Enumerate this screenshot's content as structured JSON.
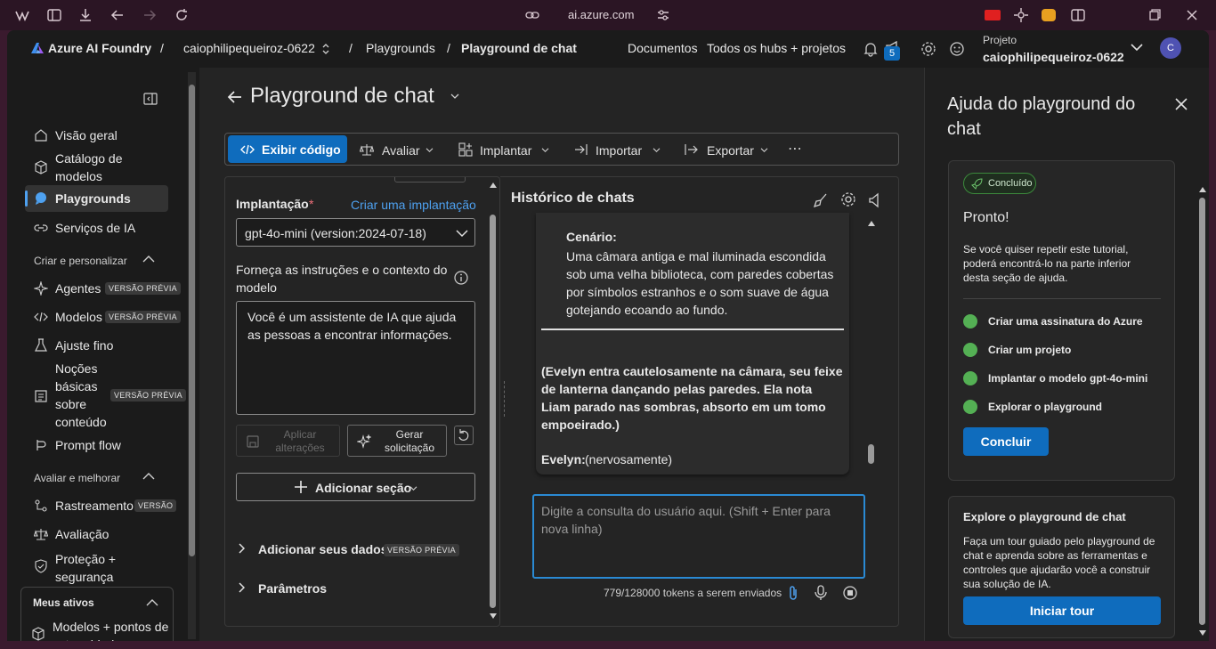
{
  "browser": {
    "url": "ai.azure.com"
  },
  "topnav": {
    "brand": "Azure AI Foundry",
    "project_crumb": "caiophilipequeiroz-0622",
    "crumb_playgrounds": "Playgrounds",
    "crumb_current": "Playground de chat",
    "docs": "Documentos",
    "all_hubs": "Todos os hubs + projetos",
    "notif_count": "5",
    "project_label": "Projeto",
    "project_name": "caiophilipequeiroz-0622",
    "avatar_initial": "C"
  },
  "sidebar": {
    "items": [
      {
        "label": "Visão geral"
      },
      {
        "label": "Catálogo de modelos"
      },
      {
        "label": "Playgrounds"
      },
      {
        "label": "Serviços de IA"
      }
    ],
    "section_create": "Criar e personalizar",
    "create_items": [
      {
        "label": "Agentes",
        "badge": "VERSÃO PRÉVIA"
      },
      {
        "label": "Modelos",
        "badge": "VERSÃO PRÉVIA"
      },
      {
        "label": "Ajuste fino"
      },
      {
        "label": "Noções básicas sobre conteúdo",
        "badge": "VERSÃO PRÉVIA"
      },
      {
        "label": "Prompt flow"
      }
    ],
    "section_eval": "Avaliar e melhorar",
    "eval_items": [
      {
        "label": "Rastreamento",
        "badge": "VERSÃO"
      },
      {
        "label": "Avaliação"
      },
      {
        "label": "Proteção + segurança"
      }
    ],
    "section_assets": "Meus ativos",
    "assets_items": [
      {
        "label": "Modelos + pontos de extremidade"
      }
    ]
  },
  "page": {
    "title": "Playground de chat"
  },
  "toolbar": {
    "view_code": "Exibir código",
    "evaluate": "Avaliar",
    "deploy": "Implantar",
    "import": "Importar",
    "export": "Exportar"
  },
  "setup": {
    "deployment_label": "Implantação",
    "create_deployment": "Criar uma implantação",
    "deployment_value": "gpt-4o-mini (version:2024-07-18)",
    "instructions_label": "Forneça as instruções e o contexto do modelo",
    "instructions_value": "Você é um assistente de IA que ajuda as pessoas a encontrar informações.",
    "apply_changes": "Aplicar alterações",
    "generate_prompt": "Gerar solicitação",
    "add_section": "Adicionar seção",
    "add_data": "Adicionar seus dados",
    "add_data_badge": "VERSÃO PRÉVIA",
    "parameters": "Parâmetros"
  },
  "chat": {
    "title": "Histórico de chats",
    "scenario_label": "Cenário:",
    "scenario_text": "Uma câmara antiga e mal iluminada escondida sob uma velha biblioteca, com paredes cobertas por símbolos estranhos e o som suave de água gotejando ecoando ao fundo.",
    "action_text": "(Evelyn entra cautelosamente na câmara, seu feixe de lanterna dançando pelas paredes. Ela nota Liam parado nas sombras, absorto em um tomo empoeirado.)",
    "speaker": "Evelyn:",
    "speaker_text": "(nervosamente)",
    "input_placeholder": "Digite a consulta do usuário aqui. (Shift + Enter para nova linha)",
    "token_count": "779/128000 tokens a serem enviados"
  },
  "help": {
    "title": "Ajuda do playground do chat",
    "status_badge": "Concluído",
    "ready_title": "Pronto!",
    "ready_text": "Se você quiser repetir este tutorial, poderá encontrá-lo na parte inferior desta seção de ajuda.",
    "steps": [
      {
        "label": "Criar uma assinatura do Azure"
      },
      {
        "label": "Criar um projeto"
      },
      {
        "label": "Implantar o modelo gpt-4o-mini"
      },
      {
        "label": "Explorar o playground"
      }
    ],
    "finish_button": "Concluir",
    "explore_title": "Explore o playground de chat",
    "explore_text": "Faça um tour guiado pelo playground de chat e aprenda sobre as ferramentas e controles que ajudarão você a construir sua solução de IA.",
    "tour_button": "Iniciar tour"
  }
}
